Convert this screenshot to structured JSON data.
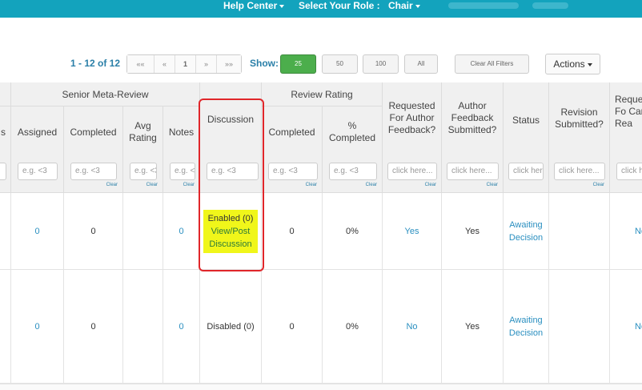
{
  "topbar": {
    "help_center": "Help Center",
    "select_role_label": "Select Your Role :",
    "role_value": "Chair"
  },
  "pagination": {
    "range_text": "1 - 12 of 12",
    "first": "««",
    "prev": "«",
    "current_page": "1",
    "next": "»",
    "last": "»»"
  },
  "show": {
    "label": "Show:",
    "options": [
      "25",
      "50",
      "100",
      "All"
    ],
    "selected": "25"
  },
  "toolbar": {
    "clear_filters_label": "Clear All Filters",
    "actions_label": "Actions"
  },
  "table": {
    "groups": {
      "senior_meta_review": "Senior Meta-Review",
      "review_rating": "Review Rating"
    },
    "headers": {
      "prev_partial": "s",
      "assigned": "Assigned",
      "completed": "Completed",
      "avg_rating": "Avg Rating",
      "notes": "Notes",
      "discussion": "Discussion",
      "rr_completed": "Completed",
      "rr_pct_completed": "% Completed",
      "requested_feedback": "Requested For Author Feedback?",
      "author_feedback_submitted": "Author Feedback Submitted?",
      "status": "Status",
      "revision_submitted": "Revision Submitted?",
      "camera_ready_partial": "Reque Fo Cam Rea"
    },
    "filter": {
      "placeholder_num": "e.g. <3",
      "placeholder_click": "click here...",
      "clear_label": "Clear"
    },
    "rows": [
      {
        "assigned": "0",
        "completed": "0",
        "avg_rating": "",
        "notes": "0",
        "discussion_state": "Enabled (0)",
        "discussion_link": "View/Post Discussion",
        "rr_completed": "0",
        "rr_pct": "0%",
        "requested_feedback": "Yes",
        "author_feedback_submitted": "Yes",
        "status": "Awaiting Decision",
        "revision_submitted": "",
        "camera_ready": "No"
      },
      {
        "assigned": "0",
        "completed": "0",
        "avg_rating": "",
        "notes": "0",
        "discussion_state": "Disabled (0)",
        "discussion_link": "",
        "rr_completed": "0",
        "rr_pct": "0%",
        "requested_feedback": "No",
        "author_feedback_submitted": "Yes",
        "status": "Awaiting Decision",
        "revision_submitted": "",
        "camera_ready": "No"
      }
    ]
  },
  "colors": {
    "topbar": "#13a3bd",
    "link": "#2a8fc0",
    "active_button": "#4cae4c",
    "highlight": "#f0f61a",
    "annotation_box": "#e0262a"
  }
}
